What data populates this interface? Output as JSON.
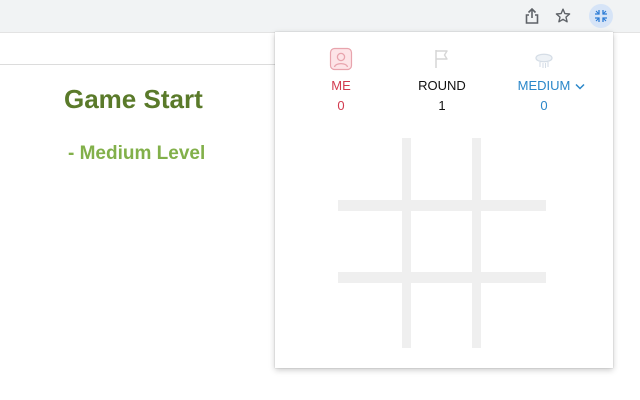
{
  "toolbar": {
    "icons": [
      "share-icon",
      "star-icon",
      "extension-icon"
    ]
  },
  "page": {
    "title": "Game Start",
    "subtitle": "- Medium Level"
  },
  "popup": {
    "scoreboard": [
      {
        "label": "ME",
        "value": "0",
        "icon": "player-icon",
        "color": "#d23b4f"
      },
      {
        "label": "ROUND",
        "value": "1",
        "icon": "flag-icon",
        "color": "#111111"
      },
      {
        "label": "MEDIUM",
        "value": "0",
        "icon": "computer-icon",
        "color": "#2a87c9"
      }
    ],
    "difficulty_dropdown_icon": "chevron-down-icon",
    "board": {
      "cells": [
        "",
        "",
        "",
        "",
        "",
        "",
        "",
        "",
        ""
      ]
    }
  },
  "colors": {
    "title": "#5a7a2a",
    "subtitle": "#82b04a",
    "board_lines": "#efefef",
    "toolbar_bg": "#f1f3f4"
  }
}
